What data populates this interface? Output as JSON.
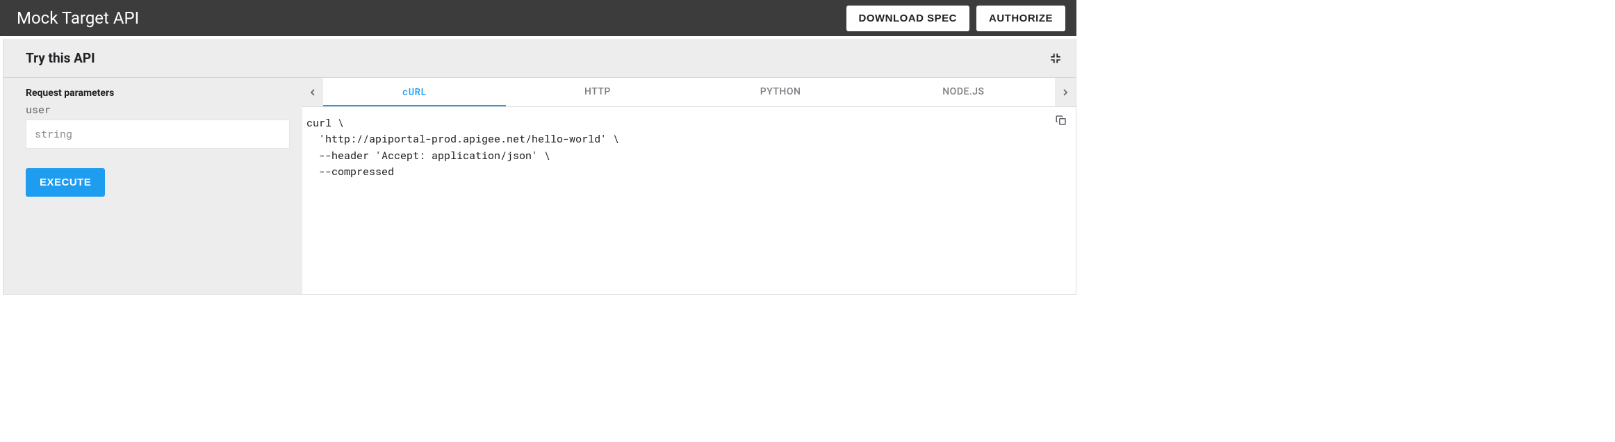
{
  "topbar": {
    "title": "Mock Target API",
    "download_label": "DOWNLOAD SPEC",
    "authorize_label": "AUTHORIZE"
  },
  "panel": {
    "title": "Try this API",
    "request_heading": "Request parameters",
    "param_name": "user",
    "param_placeholder": "string",
    "param_value": "",
    "execute_label": "EXECUTE"
  },
  "tabs": {
    "items": [
      {
        "label": "cURL",
        "active": true
      },
      {
        "label": "HTTP",
        "active": false
      },
      {
        "label": "PYTHON",
        "active": false
      },
      {
        "label": "NODE.JS",
        "active": false
      }
    ]
  },
  "code": {
    "lines": [
      "curl \\",
      "  'http://apiportal-prod.apigee.net/hello-world' \\",
      "  --header 'Accept: application/json' \\",
      "  --compressed"
    ]
  }
}
